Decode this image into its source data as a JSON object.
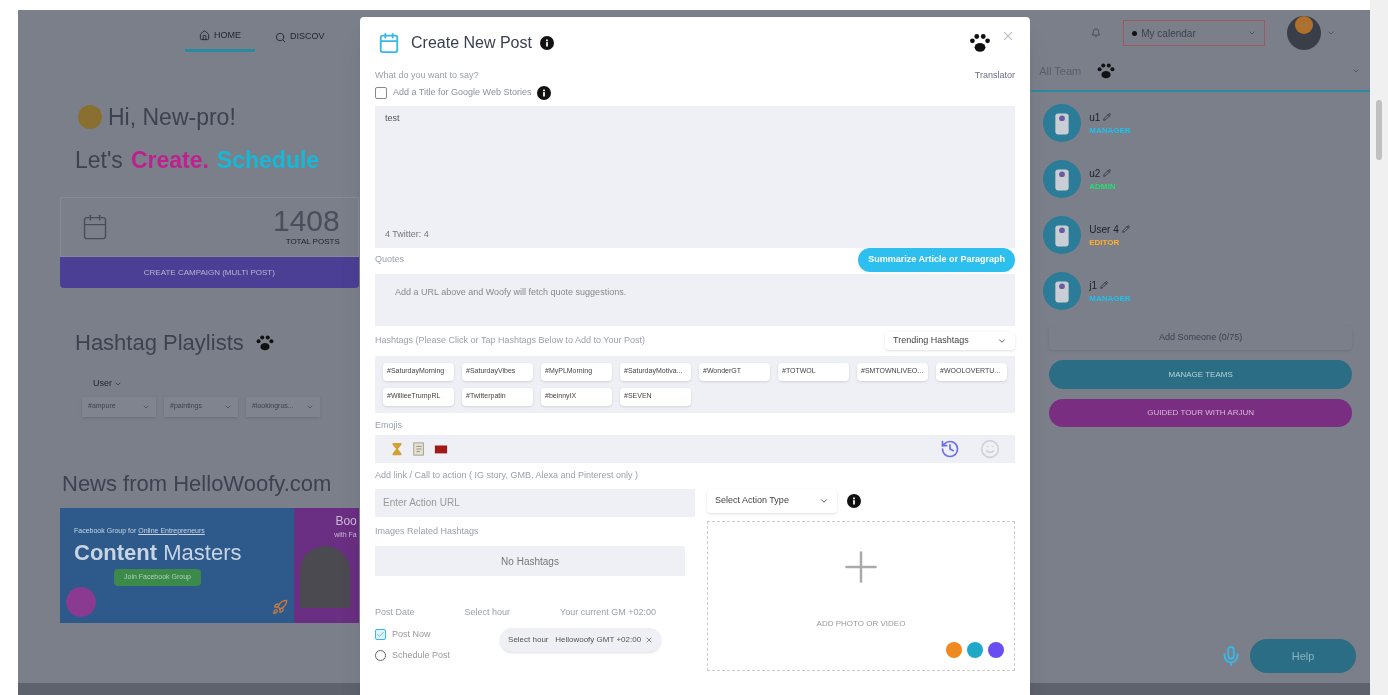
{
  "nav": {
    "tabs": [
      {
        "label": "HOME",
        "selected": true
      },
      {
        "label": "DISCOV",
        "selected": false
      }
    ]
  },
  "greeting": "Hi, New-pro!",
  "tagline": {
    "lead": "Let's",
    "words": [
      {
        "text": "Create.",
        "color": "#c0208f"
      },
      {
        "text": "Schedule",
        "color": "#16b8d8"
      }
    ]
  },
  "stats": {
    "count": "1408",
    "label": "TOTAL POSTS",
    "button": "CREATE CAMPAIGN (MULTI POST)"
  },
  "playlists": {
    "title": "Hashtag Playlists",
    "filter": "User",
    "chips": [
      "#ampure",
      "#paintings",
      "#lookingrus..."
    ]
  },
  "news": {
    "title": "News from HelloWoofy.com",
    "kicker": "Facebook Group for",
    "kicker_link": "Online Entrepreneurs",
    "headline_bold": "Content",
    "headline": "Masters",
    "cta": "Join Facebook Group",
    "side_title": "Boo",
    "side_sub": "with Fa"
  },
  "topbar": {
    "calendar": "My calendar"
  },
  "team": {
    "title": "All Team",
    "members": [
      {
        "name": "u1",
        "role": "MANAGER",
        "color": "#1ec0ec"
      },
      {
        "name": "u2",
        "role": "ADMIN",
        "color": "#22e070"
      },
      {
        "name": "User 4",
        "role": "EDITOR",
        "color": "#ffb030"
      },
      {
        "name": "j1",
        "role": "MANAGER",
        "color": "#1ec0ec"
      }
    ],
    "add": "Add Someone (0/75)",
    "manage": "MANAGE TEAMS",
    "tour": "GUIDED TOUR WITH ARJUN"
  },
  "help": "Help",
  "modal": {
    "title": "Create New Post",
    "prompt": "What do you want to say?",
    "translator": "Translator",
    "web_stories": {
      "label": "Add a Title for Google Web Stories",
      "checked": false
    },
    "post_text": "test",
    "counter": "4  Twitter: 4",
    "summarize": "Summarize Article or Paragraph",
    "quotes_label": "Quotes",
    "quotes_placeholder": "Add a URL above and Woofy will fetch quote suggestions.",
    "hashtags_label": "Hashtags (Please Click or Tap Hashtags Below to Add to Your Post)",
    "hashtags_source": "Trending Hashtags",
    "hashtags": [
      "#SaturdayMorning",
      "#SaturdayVibes",
      "#MyPLMorning",
      "#SaturdayMotiva...",
      "#WonderGT",
      "#TOTWOL",
      "#SMTOWNLIVEO...",
      "#WOOLOVERTU...",
      "#WillieeTrumpRL",
      "#Twitterpatin",
      "#beinnyIX",
      "#SEVEN"
    ],
    "emojis_label": "Emojis",
    "link_label": "Add link / Call to action ( IG story, GMB, Alexa and Pinterest only )",
    "link_placeholder": "Enter Action URL",
    "action_type": "Select Action Type",
    "images_label": "Images Related Hashtags",
    "images_empty": "No Hashtags",
    "date_label": "Post Date",
    "hour_label": "Select hour",
    "timezone": "Your current GM +02:00",
    "post_modes": [
      {
        "label": "Post Now",
        "selected": true
      },
      {
        "label": "Schedule Post",
        "selected": false
      }
    ],
    "hour_chip": "Select hour   Hellowoofy GMT +02:00",
    "upload": "ADD PHOTO OR VIDEO"
  }
}
